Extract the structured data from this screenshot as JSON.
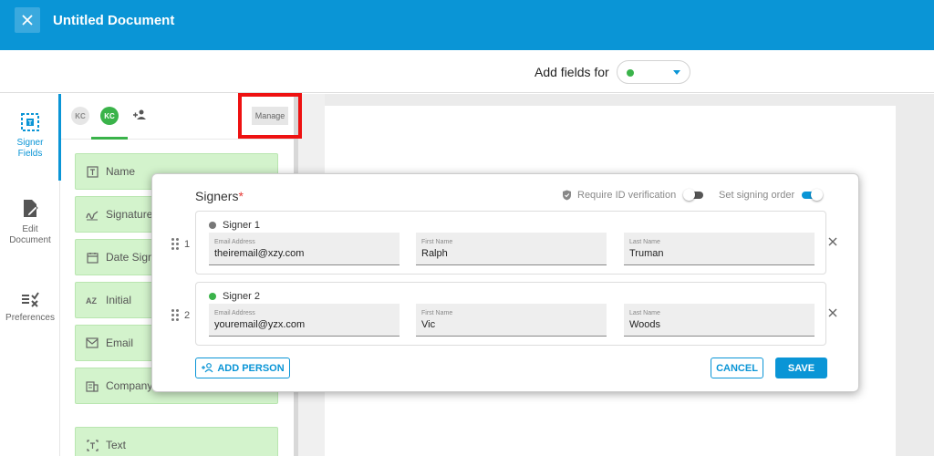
{
  "header": {
    "title": "Untitled Document",
    "close_icon": "close-icon"
  },
  "subheader": {
    "label": "Add fields for",
    "selected_signer_color": "#3ab34a"
  },
  "rail": {
    "items": [
      {
        "label_line1": "Signer",
        "label_line2": "Fields",
        "icon": "signer-fields-icon",
        "active": true
      },
      {
        "label_line1": "Edit",
        "label_line2": "Document",
        "icon": "edit-document-icon",
        "active": false
      },
      {
        "label_line1": "Preferences",
        "label_line2": "",
        "icon": "preferences-icon",
        "active": false
      }
    ]
  },
  "panel": {
    "avatars": [
      "KC",
      "KC"
    ],
    "manage_label": "Manage",
    "fields": [
      {
        "label": "Name",
        "icon": "name-field-icon"
      },
      {
        "label": "Signature",
        "icon": "signature-icon"
      },
      {
        "label": "Date Sign",
        "icon": "calendar-icon"
      },
      {
        "label": "Initial",
        "icon": "initial-icon"
      },
      {
        "label": "Email",
        "icon": "email-icon"
      },
      {
        "label": "Company",
        "icon": "company-icon"
      },
      {
        "label": "Text",
        "icon": "text-field-icon"
      }
    ]
  },
  "modal": {
    "title": "Signers",
    "required_mark": "*",
    "require_id_label": "Require ID verification",
    "require_id_on": false,
    "signing_order_label": "Set signing order",
    "signing_order_on": true,
    "signers": [
      {
        "order": "1",
        "name": "Signer 1",
        "color": "#777777",
        "email_label": "Email Address",
        "email": "theiremail@xzy.com",
        "first_label": "First Name",
        "first": "Ralph",
        "last_label": "Last Name",
        "last": "Truman"
      },
      {
        "order": "2",
        "name": "Signer 2",
        "color": "#3ab34a",
        "email_label": "Email Address",
        "email": "youremail@yzx.com",
        "first_label": "First Name",
        "first": "Vic",
        "last_label": "Last Name",
        "last": "Woods"
      }
    ],
    "add_person_label": "ADD PERSON",
    "cancel_label": "CANCEL",
    "save_label": "SAVE"
  }
}
